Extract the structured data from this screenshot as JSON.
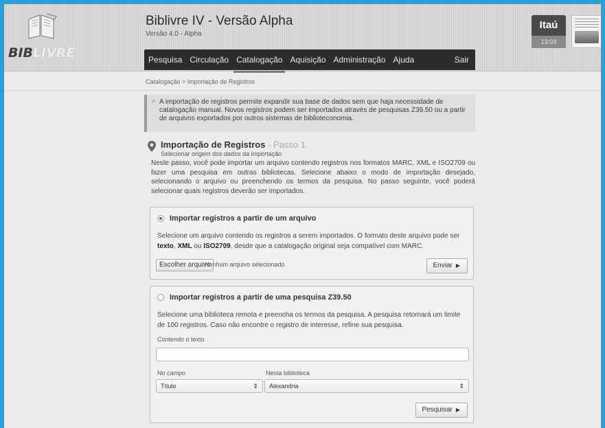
{
  "header": {
    "logo_dark": "BIB",
    "logo_light": "LIVRE",
    "app_title": "Biblivre IV - Versão Alpha",
    "app_version": "Versão 4.0 - Alpha",
    "bank_name": "Itaú",
    "time": "13:03"
  },
  "nav": {
    "items": [
      {
        "label": "Pesquisa"
      },
      {
        "label": "Circulação"
      },
      {
        "label": "Catalogação"
      },
      {
        "label": "Aquisição"
      },
      {
        "label": "Administração"
      },
      {
        "label": "Ajuda"
      }
    ],
    "active": "Catalogação",
    "exit_label": "Sair"
  },
  "breadcrumb": "Catalogação > Importação de Registros",
  "info": {
    "close_glyph": "×",
    "text": "A importação de registros permite expandir sua base de dados sem que haja necessidade de catalogação manual. Novos registros podem ser importados através de pesquisas Z39.50 ou a partir de arquivos exportados por outros sistemas de biblioteconomia."
  },
  "section": {
    "title": "Importação de Registros",
    "step": "- Passo 1",
    "subtitle": "Selecionar origem dos dados da importação",
    "intro": "Neste passo, você pode importar um arquivo contendo registros nos formatos MARC, XML e ISO2709 ou fazer uma pesquisa em outras bibliotecas. Selecione abaixo o modo de importação desejado, selecionando o arquivo ou preenchendo os termos da pesquisa. No passo seguinte, você poderá selecionar quais registros deverão ser importados."
  },
  "file_import": {
    "label": "Importar registros a partir de um arquivo",
    "selected": true,
    "desc_1": "Selecione um arquivo contendo os registros a serem importados. O formato deste arquivo pode ser ",
    "fmt_text": "texto",
    "sep_1": ", ",
    "fmt_xml": "XML",
    "sep_2": " ou ",
    "fmt_iso": "ISO2709",
    "desc_2": ", desde que a catalogação original seja compatível com MARC.",
    "choose_button": "Escolher arquivo",
    "no_file": "Nenhum arquivo selecionado",
    "send_button": "Enviar"
  },
  "z3950_import": {
    "label": "Importar registros a partir de uma pesquisa Z39.50",
    "selected": false,
    "desc": "Selecione uma biblioteca remota e preencha os termos da pesquisa. A pesquisa retornará um limite de 100 registros. Caso não encontre o registro de interesse, refine sua pesquisa.",
    "text_label": "Contendo o texto",
    "text_value": "",
    "field_label": "No campo",
    "field_value": "Título",
    "library_label": "Nesta biblioteca",
    "library_value": "Alexandria",
    "search_button": "Pesquisar"
  },
  "icons": {
    "caret": "▶",
    "select_caret": "⇕"
  }
}
